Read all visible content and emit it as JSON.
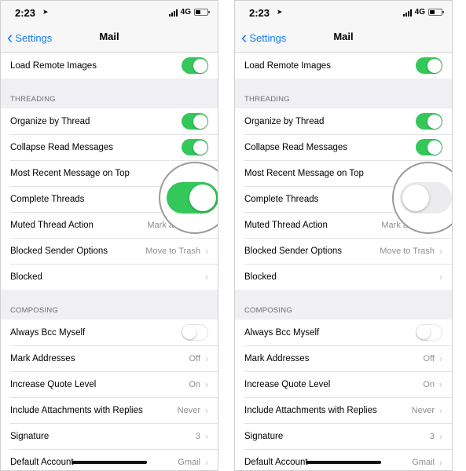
{
  "status": {
    "time": "2:23",
    "network": "4G",
    "location_icon": "location-arrow-icon"
  },
  "nav": {
    "back_label": "Settings",
    "title": "Mail"
  },
  "rows": {
    "load_remote_images": "Load Remote Images",
    "threading_header": "THREADING",
    "organize_by_thread": "Organize by Thread",
    "collapse_read": "Collapse Read Messages",
    "most_recent_top": "Most Recent Message on Top",
    "complete_threads": "Complete Threads",
    "muted_thread_action": "Muted Thread Action",
    "muted_thread_value": "Mark a",
    "blocked_sender_options": "Blocked Sender Options",
    "blocked_sender_value": "Move to Trash",
    "blocked": "Blocked",
    "composing_header": "COMPOSING",
    "always_bcc": "Always Bcc Myself",
    "mark_addresses": "Mark Addresses",
    "mark_addresses_value": "Off",
    "increase_quote": "Increase Quote Level",
    "increase_quote_value": "On",
    "include_attachments": "Include Attachments with Replies",
    "include_attachments_value": "Never",
    "signature": "Signature",
    "signature_value": "3",
    "default_account": "Default Account",
    "default_account_value": "Gmail"
  },
  "states": {
    "left": {
      "complete_threads": "on"
    },
    "right": {
      "complete_threads": "off"
    }
  },
  "colors": {
    "accent": "#1a7bf2",
    "toggle_on": "#34c759",
    "background": "#efeff4"
  }
}
